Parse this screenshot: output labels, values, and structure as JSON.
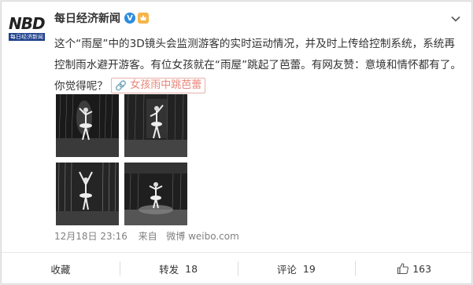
{
  "account": {
    "logo_text": "NBD",
    "logo_subtext": "每日经济新闻",
    "name": "每日经济新闻",
    "verified_badge": "V"
  },
  "post": {
    "text_before_link": "这个“雨屋”中的3D镜头会监测游客的实时运动情况，并及时上传给控制系统，系统再控制雨水避开游客。有位女孩就在“雨屋”跳起了芭蕾。有网友赞：意境和情怀都有了。你觉得呢？",
    "link_icon": "🔗",
    "link_label": "女孩雨中跳芭蕾",
    "images": [
      "rain-room-ballet-1",
      "rain-room-ballet-2",
      "rain-room-ballet-3",
      "rain-room-ballet-4"
    ]
  },
  "meta": {
    "date": "12月18日 23:16",
    "source_prefix": "来自",
    "source": "微博 weibo.com"
  },
  "actions": {
    "favorite_label": "收藏",
    "repost_label": "转发",
    "repost_count": "18",
    "comment_label": "评论",
    "comment_count": "19",
    "like_count": "163"
  },
  "colors": {
    "link": "#e8857a",
    "meta": "#808080",
    "verified": "#2b8de0",
    "brand_blue": "#1d3f8c"
  }
}
